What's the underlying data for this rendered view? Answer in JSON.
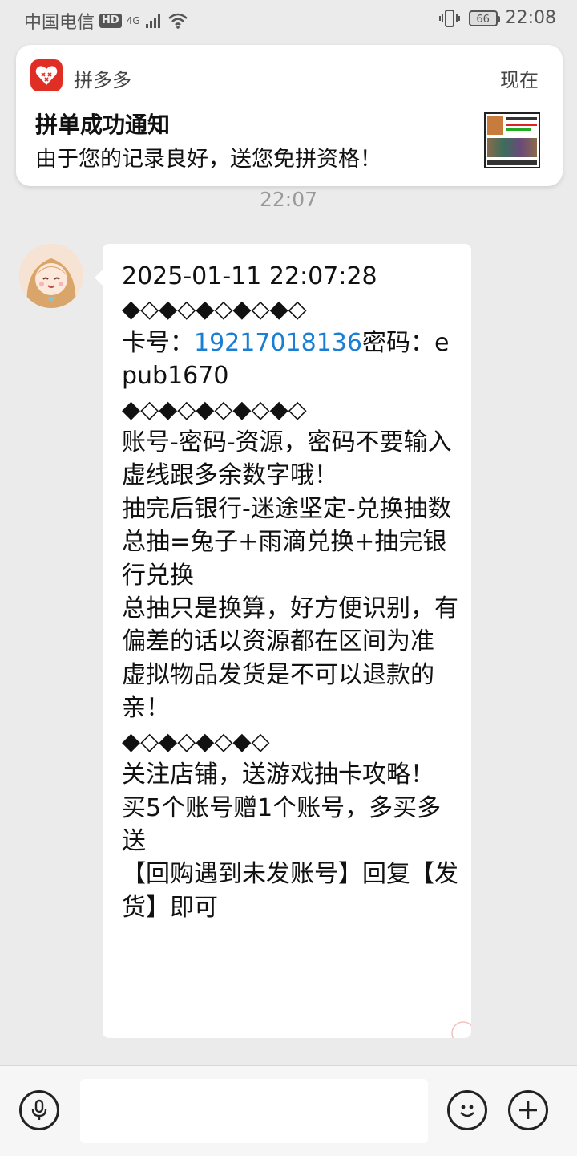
{
  "status_bar": {
    "carrier": "中国电信",
    "hd": "HD",
    "network": "4G",
    "battery": "66",
    "time": "22:08"
  },
  "notification": {
    "app_name": "拼多多",
    "time": "现在",
    "title": "拼单成功通知",
    "body": "由于您的记录良好，送您免拼资格！",
    "brand_color": "#e02e24"
  },
  "chat": {
    "timestamp": "22:07",
    "message": {
      "line1": "2025-01-11 22:07:28\n◆◇◆◇◆◇◆◇◆◇\n卡号：",
      "card_number": "19217018136",
      "line2": "密码：epub1670\n◆◇◆◇◆◇◆◇◆◇\n账号-密码-资源，密码不要输入虚线跟多余数字哦！\n抽完后银行-迷途坚定-兑换抽数\n总抽=兔子+雨滴兑换+抽完银行兑换\n总抽只是换算，好方便识别，有偏差的话以资源都在区间为准\n虚拟物品发货是不可以退款的亲！\n◆◇◆◇◆◇◆◇\n关注店铺，送游戏抽卡攻略！\n买5个账号赠1个账号，多买多送\n【回购遇到未发账号】回复【发货】即可"
    }
  },
  "input_bar": {
    "voice_icon": "microphone-icon",
    "emoji_icon": "smiley-icon",
    "add_icon": "plus-icon"
  }
}
